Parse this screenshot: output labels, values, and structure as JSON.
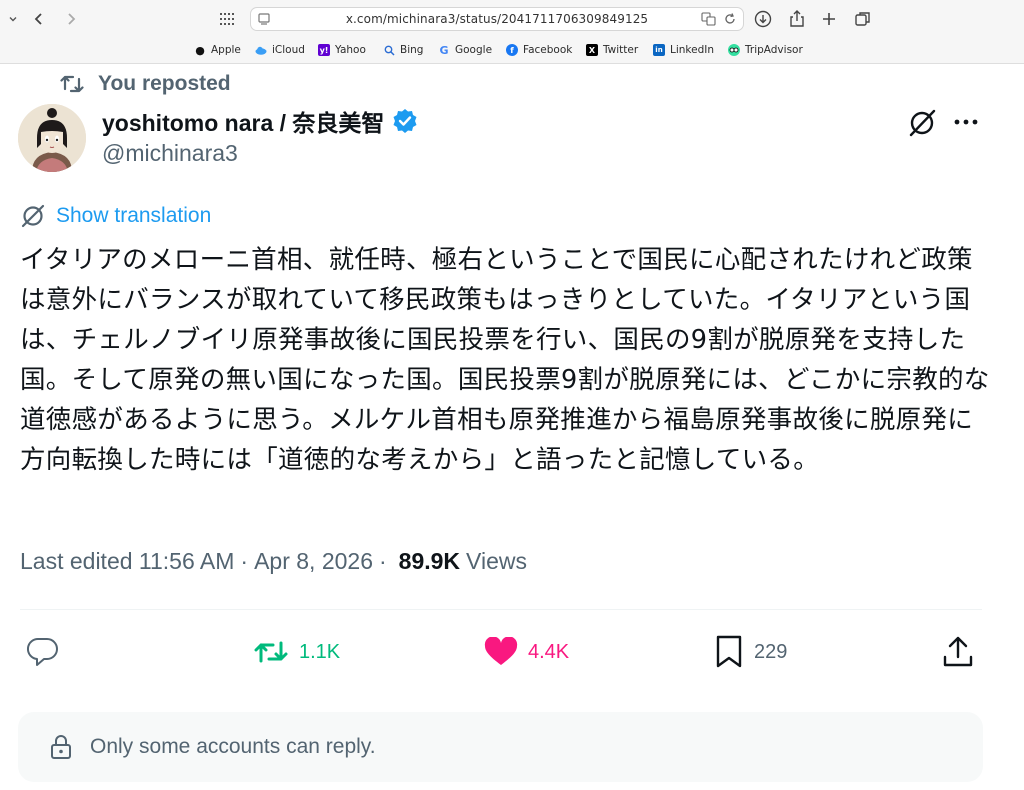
{
  "browser": {
    "url": "x.com/michinara3/status/2041711706309849125",
    "bookmarks": [
      {
        "label": "Apple",
        "icon": "apple-icon"
      },
      {
        "label": "iCloud",
        "icon": "icloud-icon"
      },
      {
        "label": "Yahoo",
        "icon": "yahoo-icon"
      },
      {
        "label": "Bing",
        "icon": "bing-icon"
      },
      {
        "label": "Google",
        "icon": "google-icon"
      },
      {
        "label": "Facebook",
        "icon": "facebook-icon"
      },
      {
        "label": "Twitter",
        "icon": "twitter-icon"
      },
      {
        "label": "LinkedIn",
        "icon": "linkedin-icon"
      },
      {
        "label": "TripAdvisor",
        "icon": "tripadvisor-icon"
      }
    ]
  },
  "tweet": {
    "repost_label": "You reposted",
    "author_name": "yoshitomo nara / 奈良美智",
    "handle": "@michinara3",
    "translate_label": "Show translation",
    "text": "イタリアのメローニ首相、就任時、極右ということで国民に心配されたけれど政策は意外にバランスが取れていて移民政策もはっきりとしていた。イタリアという国は、チェルノブイリ原発事故後に国民投票を行い、国民の9割が脱原発を支持した国。そして原発の無い国になった国。国民投票9割が脱原発には、どこかに宗教的な道徳感があるように思う。メルケル首相も原発推進から福島原発事故後に脱原発に方向転換した時には「道徳的な考えから」と語ったと記憶している。",
    "last_edited": "Last edited 11:56 AM",
    "date": "Apr 8, 2026",
    "views_count": "89.9K",
    "views_label": "Views",
    "actions": {
      "retweets": "1.1K",
      "likes": "4.4K",
      "bookmarks": "229"
    },
    "reply_restriction": "Only some accounts can reply."
  },
  "colors": {
    "accent": "#1d9bf0",
    "retweet_green": "#00ba7c",
    "like_pink": "#f91880",
    "muted": "#536471"
  }
}
